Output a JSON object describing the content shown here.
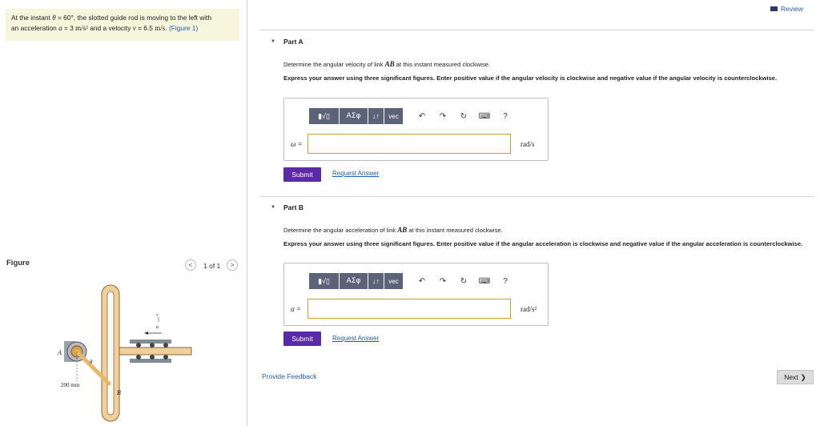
{
  "problem": {
    "text_1": "At the instant ",
    "theta": "θ",
    "text_2": " = 60°, the slotted guide rod is moving to the left with",
    "text_3": "an acceleration ",
    "a_var": "a",
    "text_4": " = 3 ",
    "a_unit": "m/s²",
    "text_5": " and a velocity ",
    "v_var": "v",
    "text_6": " = 6.5 ",
    "v_unit": "m/s",
    "text_7": ". ",
    "figure_link": "(Figure 1)"
  },
  "figure": {
    "label": "Figure",
    "pager_prev": "<",
    "pager_text": "1 of 1",
    "pager_next": ">",
    "label_A": "A",
    "label_B": "B",
    "label_theta": "θ",
    "label_v": "v",
    "label_a": "a",
    "dimension": "200 mm"
  },
  "header": {
    "review_label": "Review"
  },
  "part_a": {
    "title": "Part A",
    "question_1": "Determine the angular velocity of link ",
    "link_var": "AB",
    "question_2": " at this instant measured clockwise.",
    "instruction": "Express your answer using three significant figures. Enter positive value if the angular velocity is clockwise and negative value if the angular velocity is counterclockwise.",
    "variable": "ω =",
    "unit": "rad/s",
    "submit_label": "Submit",
    "request_label": "Request Answer"
  },
  "part_b": {
    "title": "Part B",
    "question_1": "Determine the angular acceleration of link ",
    "link_var": "AB",
    "question_2": " at this instant measured clockwise.",
    "instruction": "Express your answer using three significant figures. Enter positive value if the angular acceleration is clockwise and negative value if the angular acceleration is counterclockwise.",
    "variable": "α =",
    "unit": "rad/s²",
    "submit_label": "Submit",
    "request_label": "Request Answer"
  },
  "toolbar": {
    "greek_label": "ΑΣφ",
    "arrows_label": "↓↑",
    "vec_label": "vec",
    "help_label": "?",
    "icons": [
      "templates-icon",
      "greek-icon",
      "subscript-icon",
      "vector-icon",
      "undo-icon",
      "redo-icon",
      "reset-icon",
      "keyboard-icon",
      "help-icon"
    ]
  },
  "footer": {
    "feedback_label": "Provide Feedback",
    "next_label": "Next",
    "next_arrow": "❯"
  },
  "colors": {
    "problem_bg": "#f6f6dc",
    "submit_bg": "#5b2aa9",
    "toolbar_bg": "#5b6378",
    "link": "#2460a8",
    "input_border": "#c9a227",
    "rod_fill": "#f1cf9a"
  }
}
